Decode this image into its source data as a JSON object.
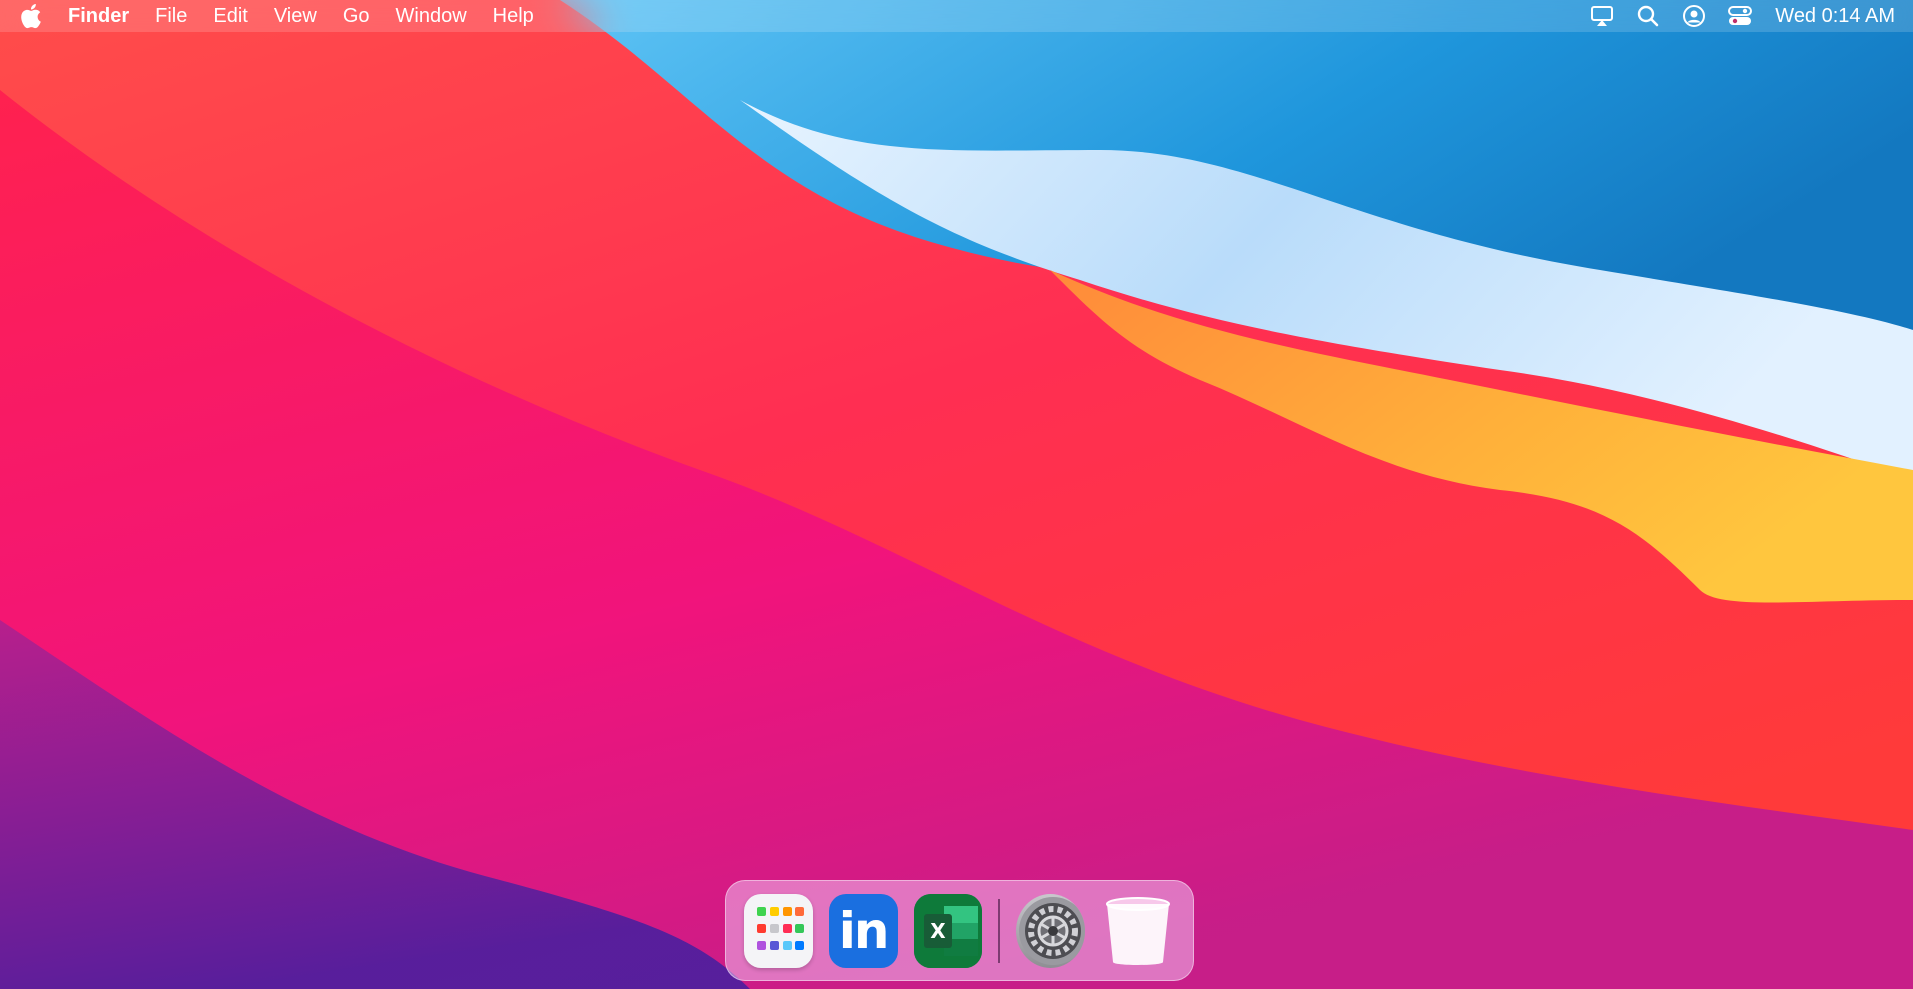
{
  "menubar": {
    "apple_icon": "apple-logo-icon",
    "app_name": "Finder",
    "menus": [
      "File",
      "Edit",
      "View",
      "Go",
      "Window",
      "Help"
    ],
    "status_icons": [
      "airplay-icon",
      "search-icon",
      "user-account-icon",
      "control-center-icon"
    ],
    "clock": "Wed 0:14 AM"
  },
  "dock": {
    "apps": [
      {
        "name": "Launchpad",
        "icon": "launchpad-icon"
      },
      {
        "name": "LinkedIn",
        "icon": "linkedin-icon",
        "glyph": "in"
      },
      {
        "name": "Microsoft Excel",
        "icon": "excel-icon",
        "glyph": "X"
      },
      {
        "name": "System Preferences",
        "icon": "gear-icon"
      },
      {
        "name": "Trash",
        "icon": "trash-icon"
      }
    ]
  },
  "colors": {
    "wallpaper_red": "#ff3b4a",
    "wallpaper_magenta": "#f0157e",
    "wallpaper_blue": "#1e8fd8",
    "wallpaper_orange": "#ffa02e",
    "linkedin_blue": "#1a6fe0",
    "excel_green": "#0e7a3a"
  }
}
